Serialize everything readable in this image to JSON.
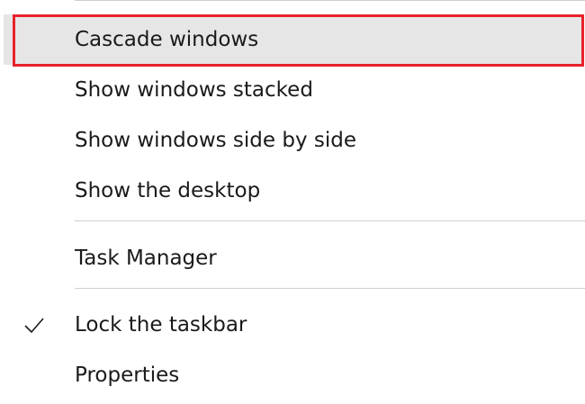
{
  "menu": {
    "items": [
      {
        "label": "Cascade windows"
      },
      {
        "label": "Show windows stacked"
      },
      {
        "label": "Show windows side by side"
      },
      {
        "label": "Show the desktop"
      },
      {
        "label": "Task Manager"
      },
      {
        "label": "Lock the taskbar",
        "checked": true,
        "icon": "check-icon"
      },
      {
        "label": "Properties"
      }
    ]
  },
  "colors": {
    "highlight_bg": "#e6e6e6",
    "highlight_outline": "#e8212a",
    "separator": "#d0d0d0",
    "text": "#1a1a1a"
  }
}
